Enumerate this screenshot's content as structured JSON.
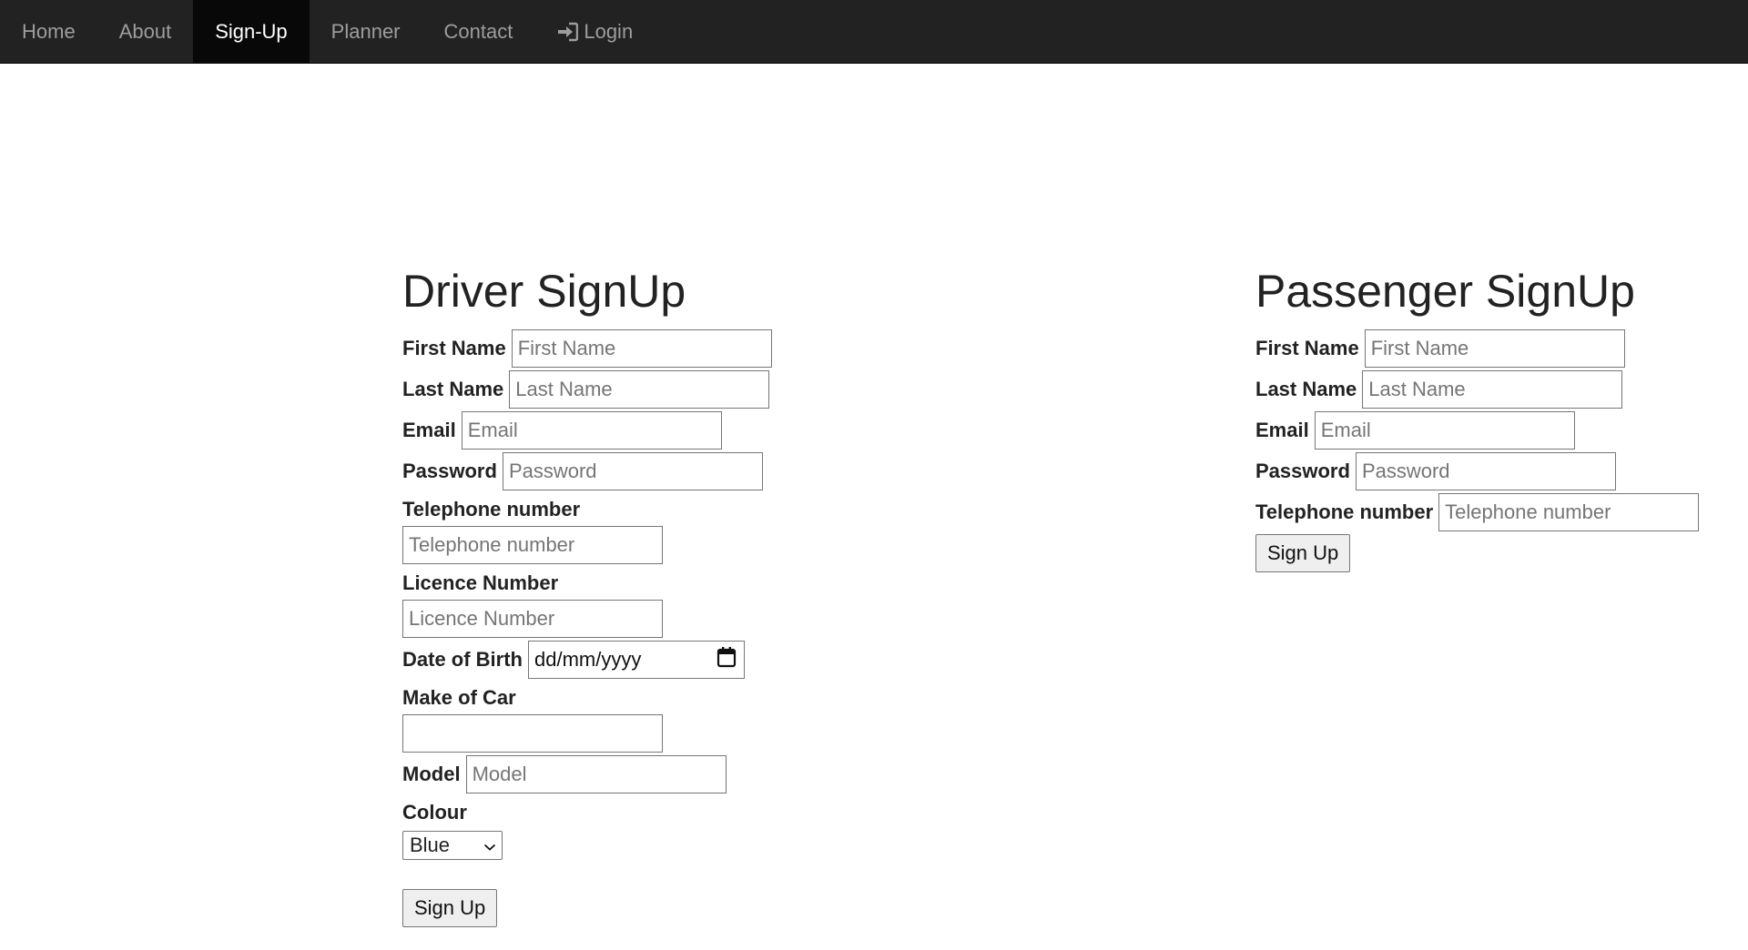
{
  "nav": {
    "items": [
      {
        "label": "Home"
      },
      {
        "label": "About"
      },
      {
        "label": "Sign-Up"
      },
      {
        "label": "Planner"
      },
      {
        "label": "Contact"
      },
      {
        "label": "Login"
      }
    ],
    "active": "Sign-Up",
    "login_icon": "sign-in-icon"
  },
  "driver": {
    "title": "Driver SignUp",
    "first_name": {
      "label": "First Name",
      "placeholder": "First Name"
    },
    "last_name": {
      "label": "Last Name",
      "placeholder": "Last Name"
    },
    "email": {
      "label": "Email",
      "placeholder": "Email"
    },
    "password": {
      "label": "Password",
      "placeholder": "Password"
    },
    "telephone": {
      "label": "Telephone number",
      "placeholder": "Telephone number"
    },
    "licence": {
      "label": "Licence Number",
      "placeholder": "Licence Number"
    },
    "dob": {
      "label": "Date of Birth",
      "placeholder": "dd/mm/yyyy",
      "icon": "calendar-icon"
    },
    "make": {
      "label": "Make of Car",
      "placeholder": ""
    },
    "model": {
      "label": "Model",
      "placeholder": "Model"
    },
    "colour": {
      "label": "Colour",
      "selected": "Blue",
      "icon": "chevron-down-icon"
    },
    "submit_label": "Sign Up"
  },
  "passenger": {
    "title": "Passenger SignUp",
    "first_name": {
      "label": "First Name",
      "placeholder": "First Name"
    },
    "last_name": {
      "label": "Last Name",
      "placeholder": "Last Name"
    },
    "email": {
      "label": "Email",
      "placeholder": "Email"
    },
    "password": {
      "label": "Password",
      "placeholder": "Password"
    },
    "telephone": {
      "label": "Telephone number",
      "placeholder": "Telephone number"
    },
    "submit_label": "Sign Up"
  },
  "colors": {
    "navbar_bg": "#222222",
    "navbar_active_bg": "#080808",
    "nav_text": "#9d9d9d",
    "nav_active_text": "#ffffff"
  }
}
